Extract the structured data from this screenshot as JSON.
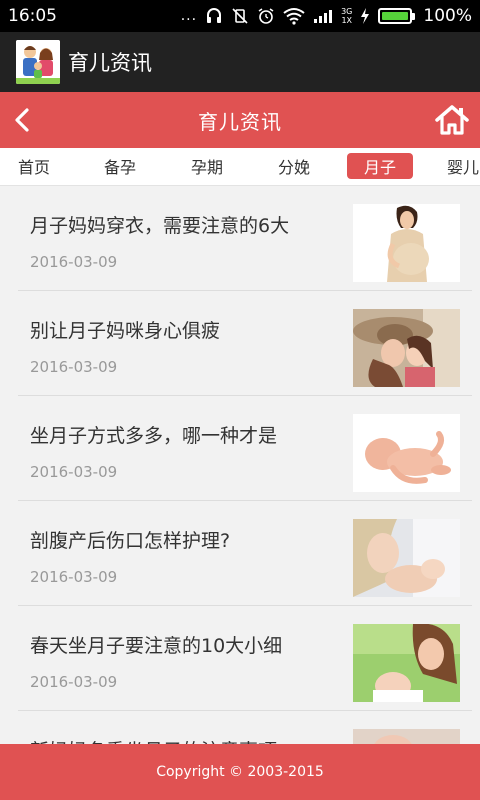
{
  "status_bar": {
    "time": "16:05",
    "dots": "...",
    "net_top": "3G",
    "net_bottom": "1X",
    "battery_percent": "100%",
    "battery_level": 1.0
  },
  "app_bar": {
    "title": "育儿资讯",
    "logo_icon": "family-logo-icon"
  },
  "header": {
    "title": "育儿资讯",
    "back_icon": "chevron-left-icon",
    "home_icon": "home-icon"
  },
  "tabs": [
    {
      "label": "首页",
      "active": false
    },
    {
      "label": "备孕",
      "active": false
    },
    {
      "label": "孕期",
      "active": false
    },
    {
      "label": "分娩",
      "active": false
    },
    {
      "label": "月子",
      "active": true
    },
    {
      "label": "婴儿",
      "active": false
    }
  ],
  "articles": [
    {
      "title": "月子妈妈穿衣，需要注意的6大",
      "date": "2016-03-09",
      "thumb": "pregnant-woman-photo"
    },
    {
      "title": "别让月子妈咪身心俱疲",
      "date": "2016-03-09",
      "thumb": "mother-kissing-child-photo"
    },
    {
      "title": "坐月子方式多多，哪一种才是",
      "date": "2016-03-09",
      "thumb": "newborn-baby-photo"
    },
    {
      "title": "剖腹产后伤口怎样护理?",
      "date": "2016-03-09",
      "thumb": "mother-with-baby-photo"
    },
    {
      "title": "春天坐月子要注意的10大小细",
      "date": "2016-03-09",
      "thumb": "mother-smiling-baby-photo"
    },
    {
      "title": "新妈妈冬季坐月子的注意事项",
      "date": "",
      "thumb": "partial-photo"
    }
  ],
  "footer": {
    "copyright": "Copyright © 2003-2015"
  },
  "colors": {
    "accent": "#e05252",
    "app_bar": "#222222",
    "list_bg": "#f2f2f2"
  }
}
